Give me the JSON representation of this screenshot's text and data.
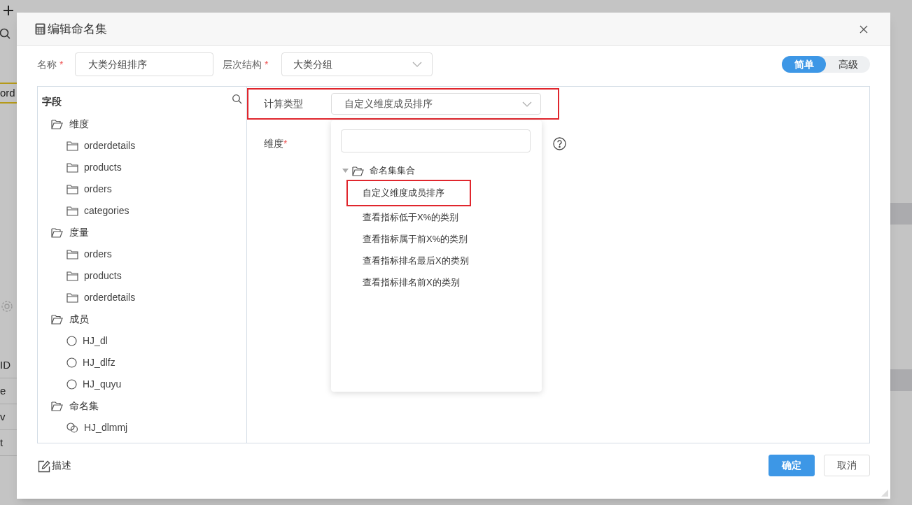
{
  "background": {
    "fragments": [
      {
        "text": "ord",
        "highlighted": true
      },
      {
        "text": "ID",
        "highlighted": false
      },
      {
        "text": "e",
        "highlighted": false
      },
      {
        "text": "v",
        "highlighted": false
      },
      {
        "text": "t",
        "highlighted": false
      }
    ]
  },
  "dialog": {
    "title": "编辑命名集",
    "name": {
      "label": "名称",
      "required_mark": "*",
      "value": "大类分组排序"
    },
    "hierarchy": {
      "label": "层次结构",
      "required_mark": "*",
      "value": "大类分组"
    },
    "mode_toggle": [
      {
        "label": "简单",
        "selected": true
      },
      {
        "label": "高级",
        "selected": false
      }
    ],
    "fields_panel": {
      "title": "字段",
      "groups": [
        {
          "label": "维度",
          "children": [
            {
              "label": "orderdetails",
              "kind": "folder"
            },
            {
              "label": "products",
              "kind": "folder"
            },
            {
              "label": "orders",
              "kind": "folder"
            },
            {
              "label": "categories",
              "kind": "folder"
            }
          ]
        },
        {
          "label": "度量",
          "children": [
            {
              "label": "orders",
              "kind": "folder"
            },
            {
              "label": "products",
              "kind": "folder"
            },
            {
              "label": "orderdetails",
              "kind": "folder"
            }
          ]
        },
        {
          "label": "成员",
          "children": [
            {
              "label": "HJ_dl",
              "kind": "member"
            },
            {
              "label": "HJ_dlfz",
              "kind": "member"
            },
            {
              "label": "HJ_quyu",
              "kind": "member"
            }
          ]
        },
        {
          "label": "命名集",
          "children": [
            {
              "label": "HJ_dlmmj",
              "kind": "named_set"
            }
          ]
        }
      ]
    },
    "calc_type": {
      "label": "计算类型",
      "value": "自定义维度成员排序",
      "highlighted": true
    },
    "dimension": {
      "label": "维度",
      "required_mark": "*"
    },
    "dropdown": {
      "group": {
        "label": "命名集集合",
        "expanded": true,
        "children": [
          {
            "label": "自定义维度成员排序",
            "highlighted": true
          },
          {
            "label": "查看指标低于X%的类别",
            "highlighted": false
          },
          {
            "label": "查看指标属于前X%的类别",
            "highlighted": false
          },
          {
            "label": "查看指标排名最后X的类别",
            "highlighted": false
          },
          {
            "label": "查看指标排名前X的类别",
            "highlighted": false
          }
        ]
      }
    },
    "describe": "描述",
    "buttons": [
      {
        "label": "确定",
        "kind": "primary"
      },
      {
        "label": "取消",
        "kind": "secondary"
      }
    ]
  }
}
